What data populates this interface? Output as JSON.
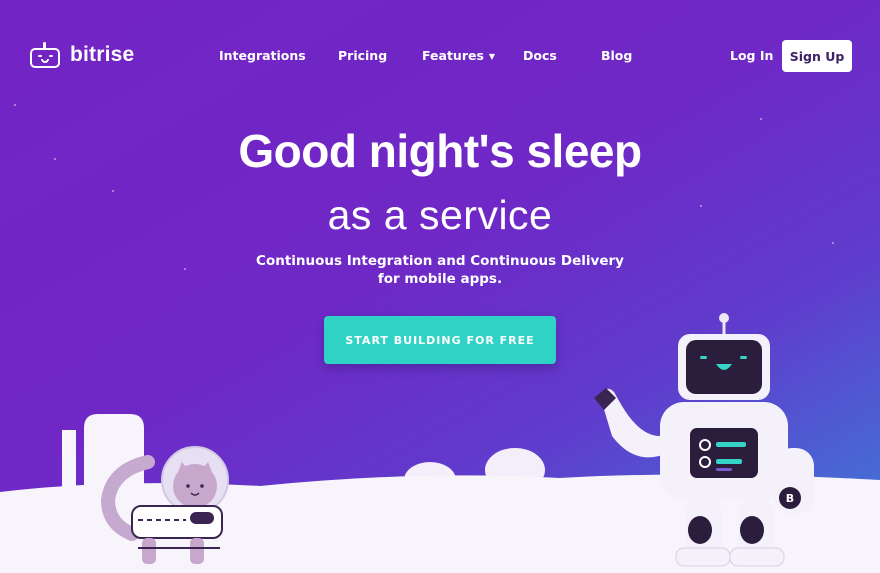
{
  "brand": {
    "name": "bitrise"
  },
  "nav": {
    "links": [
      {
        "label": "Integrations"
      },
      {
        "label": "Pricing"
      },
      {
        "label": "Features"
      },
      {
        "label": "Docs"
      },
      {
        "label": "Blog"
      }
    ],
    "login_label": "Log In",
    "signup_label": "Sign Up"
  },
  "hero": {
    "title": "Good night's sleep",
    "subtitle": "as a service",
    "description_line1": "Continuous Integration and Continuous Delivery",
    "description_line2": "for mobile apps.",
    "cta_label": "START BUILDING FOR FREE"
  },
  "illustration": {
    "robot_badge": "B",
    "icons": [
      "robot-mascot-illustration",
      "astronaut-cat-illustration",
      "moon-surface-illustration"
    ]
  },
  "colors": {
    "background_start": "#7224c4",
    "background_end": "#3e7fd6",
    "accent": "#2fd3c6",
    "ground": "#f7f5fb"
  }
}
